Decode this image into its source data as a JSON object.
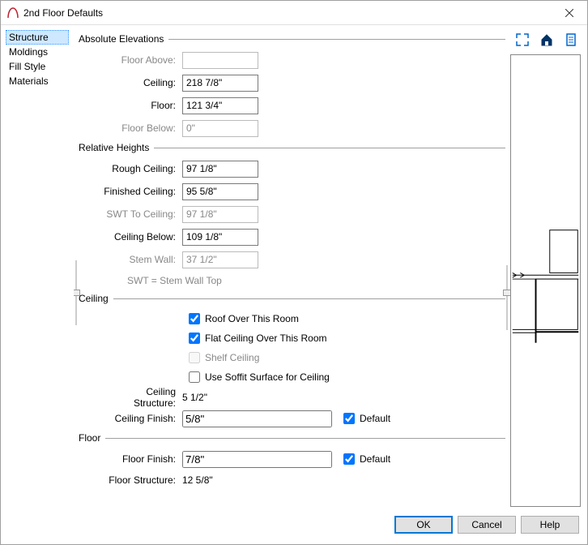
{
  "window": {
    "title": "2nd Floor Defaults"
  },
  "sidebar": {
    "items": [
      {
        "label": "Structure",
        "selected": true
      },
      {
        "label": "Moldings",
        "selected": false
      },
      {
        "label": "Fill Style",
        "selected": false
      },
      {
        "label": "Materials",
        "selected": false
      }
    ]
  },
  "sections": {
    "absElev": {
      "title": "Absolute Elevations",
      "floorAbove": {
        "label": "Floor Above:",
        "value": "",
        "enabled": false
      },
      "ceiling": {
        "label": "Ceiling:",
        "value": "218 7/8\"",
        "enabled": true
      },
      "floor": {
        "label": "Floor:",
        "value": "121 3/4\"",
        "enabled": true
      },
      "floorBelow": {
        "label": "Floor Below:",
        "value": "0\"",
        "enabled": false
      }
    },
    "relHeights": {
      "title": "Relative Heights",
      "roughCeiling": {
        "label": "Rough Ceiling:",
        "value": "97 1/8\"",
        "enabled": true
      },
      "finishedCeiling": {
        "label": "Finished Ceiling:",
        "value": "95 5/8\"",
        "enabled": true
      },
      "swtToCeiling": {
        "label": "SWT To Ceiling:",
        "value": "97 1/8\"",
        "enabled": false
      },
      "ceilingBelow": {
        "label": "Ceiling Below:",
        "value": "109 1/8\"",
        "enabled": true
      },
      "stemWall": {
        "label": "Stem Wall:",
        "value": "37 1/2\"",
        "enabled": false
      },
      "hint": "SWT = Stem Wall Top"
    },
    "ceiling": {
      "title": "Ceiling",
      "roofOver": {
        "label": "Roof Over This Room",
        "checked": true,
        "enabled": true
      },
      "flat": {
        "label": "Flat Ceiling Over This Room",
        "checked": true,
        "enabled": true
      },
      "shelf": {
        "label": "Shelf Ceiling",
        "checked": false,
        "enabled": false
      },
      "soffit": {
        "label": "Use Soffit Surface for Ceiling",
        "checked": false,
        "enabled": true
      },
      "structure": {
        "label": "Ceiling Structure:",
        "value": "5 1/2\""
      },
      "finish": {
        "label": "Ceiling Finish:",
        "value": "5/8\"",
        "defaultLabel": "Default",
        "defaultChecked": true
      }
    },
    "floor": {
      "title": "Floor",
      "finish": {
        "label": "Floor Finish:",
        "value": "7/8\"",
        "defaultLabel": "Default",
        "defaultChecked": true
      },
      "structure": {
        "label": "Floor Structure:",
        "value": "12 5/8\""
      }
    }
  },
  "buttons": {
    "ok": "OK",
    "cancel": "Cancel",
    "help": "Help"
  },
  "icons": {
    "expand": "expand-icon",
    "house": "house-icon",
    "page": "page-icon",
    "app": "arch-icon"
  }
}
